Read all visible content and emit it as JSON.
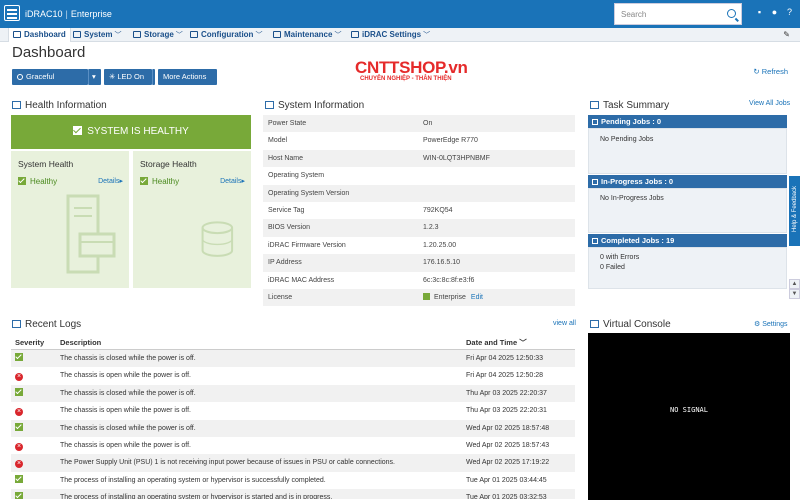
{
  "header": {
    "product": "iDRAC10",
    "edition": "Enterprise",
    "search_placeholder": "Search"
  },
  "nav": {
    "items": [
      {
        "label": "Dashboard",
        "icon": "home-icon"
      },
      {
        "label": "System",
        "icon": "server-icon"
      },
      {
        "label": "Storage",
        "icon": "storage-icon"
      },
      {
        "label": "Configuration",
        "icon": "configuration-icon"
      },
      {
        "label": "Maintenance",
        "icon": "maintenance-icon"
      },
      {
        "label": "iDRAC Settings",
        "icon": "settings-icon"
      }
    ]
  },
  "page": {
    "title": "Dashboard",
    "graceful_shutdown": "Graceful Shutdown",
    "led": "LED On",
    "more_actions": "More Actions",
    "refresh": "Refresh"
  },
  "watermark": {
    "title": "CNTTSHOP.vn",
    "subtitle": "CHUYÊN NGHIỆP - THÂN THIỆN"
  },
  "health": {
    "title": "Health Information",
    "status": "SYSTEM IS HEALTHY",
    "system_health": "System Health",
    "storage_health": "Storage Health",
    "healthy": "Healthy",
    "details": "Details"
  },
  "system_info": {
    "title": "System Information",
    "rows": [
      {
        "k": "Power State",
        "v": "On"
      },
      {
        "k": "Model",
        "v": "PowerEdge R770"
      },
      {
        "k": "Host Name",
        "v": "WIN-0LQT3HPNBMF"
      },
      {
        "k": "Operating System",
        "v": ""
      },
      {
        "k": "Operating System Version",
        "v": ""
      },
      {
        "k": "Service Tag",
        "v": "792KQ54"
      },
      {
        "k": "BIOS Version",
        "v": "1.2.3"
      },
      {
        "k": "iDRAC Firmware Version",
        "v": "1.20.25.00"
      },
      {
        "k": "IP Address",
        "v": "176.16.5.10"
      },
      {
        "k": "iDRAC MAC Address",
        "v": "6c:3c:8c:8f:e3:f6"
      },
      {
        "k": "License",
        "v": "Enterprise"
      }
    ],
    "edit": "Edit"
  },
  "tasks": {
    "title": "Task Summary",
    "view_all": "View All Jobs",
    "pending_header": "Pending Jobs : 0",
    "pending_body": "No Pending Jobs",
    "inprogress_header": "In-Progress Jobs : 0",
    "inprogress_body": "No In-Progress Jobs",
    "completed_header": "Completed Jobs : 19",
    "completed_errors": "0 with Errors",
    "completed_failed": "0 Failed"
  },
  "feedback": "Help & Feedback",
  "logs": {
    "title": "Recent Logs",
    "view_all": "view all",
    "col_severity": "Severity",
    "col_description": "Description",
    "col_datetime": "Date and Time",
    "rows": [
      {
        "sev": "ok",
        "desc": "The chassis is closed while the power is off.",
        "time": "Fri Apr 04 2025 12:50:33"
      },
      {
        "sev": "err",
        "desc": "The chassis is open while the power is off.",
        "time": "Fri Apr 04 2025 12:50:28"
      },
      {
        "sev": "ok",
        "desc": "The chassis is closed while the power is off.",
        "time": "Thu Apr 03 2025 22:20:37"
      },
      {
        "sev": "err",
        "desc": "The chassis is open while the power is off.",
        "time": "Thu Apr 03 2025 22:20:31"
      },
      {
        "sev": "ok",
        "desc": "The chassis is closed while the power is off.",
        "time": "Wed Apr 02 2025 18:57:48"
      },
      {
        "sev": "err",
        "desc": "The chassis is open while the power is off.",
        "time": "Wed Apr 02 2025 18:57:43"
      },
      {
        "sev": "err",
        "desc": "The Power Supply Unit (PSU) 1 is not receiving input power because of issues in PSU or cable connections.",
        "time": "Wed Apr 02 2025 17:19:22"
      },
      {
        "sev": "ok",
        "desc": "The process of installing an operating system or hypervisor is successfully completed.",
        "time": "Tue Apr 01 2025 03:44:45"
      },
      {
        "sev": "ok",
        "desc": "The process of installing an operating system or hypervisor is started and is in progress.",
        "time": "Tue Apr 01 2025 03:32:53"
      }
    ]
  },
  "console": {
    "title": "Virtual Console",
    "settings": "Settings",
    "no_signal": "NO SIGNAL"
  }
}
